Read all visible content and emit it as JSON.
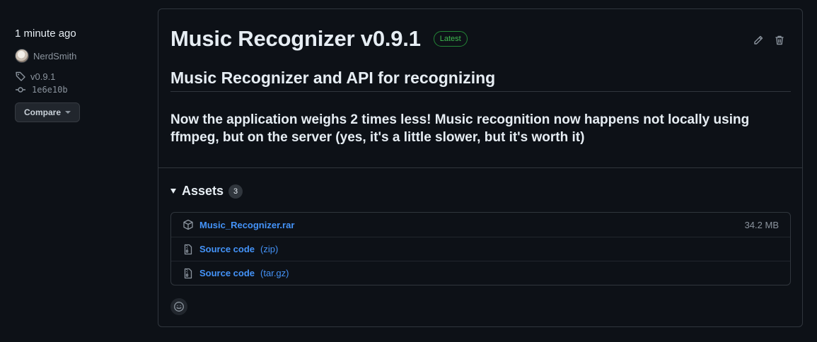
{
  "meta": {
    "time_ago": "1 minute ago",
    "author": "NerdSmith",
    "tag": "v0.9.1",
    "commit": "1e6e10b",
    "compare_label": "Compare"
  },
  "release": {
    "title": "Music Recognizer v0.9.1",
    "badge": "Latest",
    "subtitle": "Music Recognizer and API for recognizing",
    "body": "Now the application weighs 2 times less! Music recognition now happens not locally using ffmpeg, but on the server (yes, it's a little slower, but it's worth it)"
  },
  "assets": {
    "label": "Assets",
    "count": "3",
    "items": [
      {
        "name": "Music_Recognizer.rar",
        "ext": "",
        "size": "34.2 MB",
        "icon": "package-icon"
      },
      {
        "name": "Source code",
        "ext": "(zip)",
        "size": "",
        "icon": "file-zip-icon"
      },
      {
        "name": "Source code",
        "ext": "(tar.gz)",
        "size": "",
        "icon": "file-zip-icon"
      }
    ]
  },
  "colors": {
    "background": "#0d1117",
    "border": "#30363d",
    "link": "#4493f8",
    "badge_green": "#3fb950",
    "muted": "#8b949e"
  }
}
